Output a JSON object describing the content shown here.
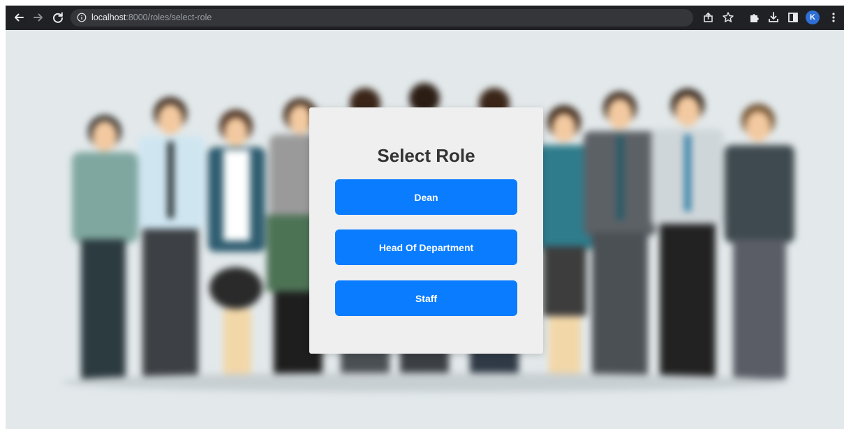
{
  "browser": {
    "url_host": "localhost",
    "url_path": ":8000/roles/select-role",
    "avatar_letter": "K",
    "icons": [
      "back-arrow-icon",
      "forward-arrow-icon",
      "reload-icon",
      "info-icon",
      "share-icon",
      "bookmark-star-icon",
      "extensions-puzzle-icon",
      "download-icon",
      "side-panel-icon",
      "kebab-menu-icon"
    ]
  },
  "modal": {
    "title": "Select Role",
    "roles": [
      "Dean",
      "Head Of Department",
      "Staff"
    ]
  },
  "colors": {
    "toolbar_bg": "#202124",
    "button_bg": "#0a7cff",
    "card_bg": "#efefef"
  }
}
